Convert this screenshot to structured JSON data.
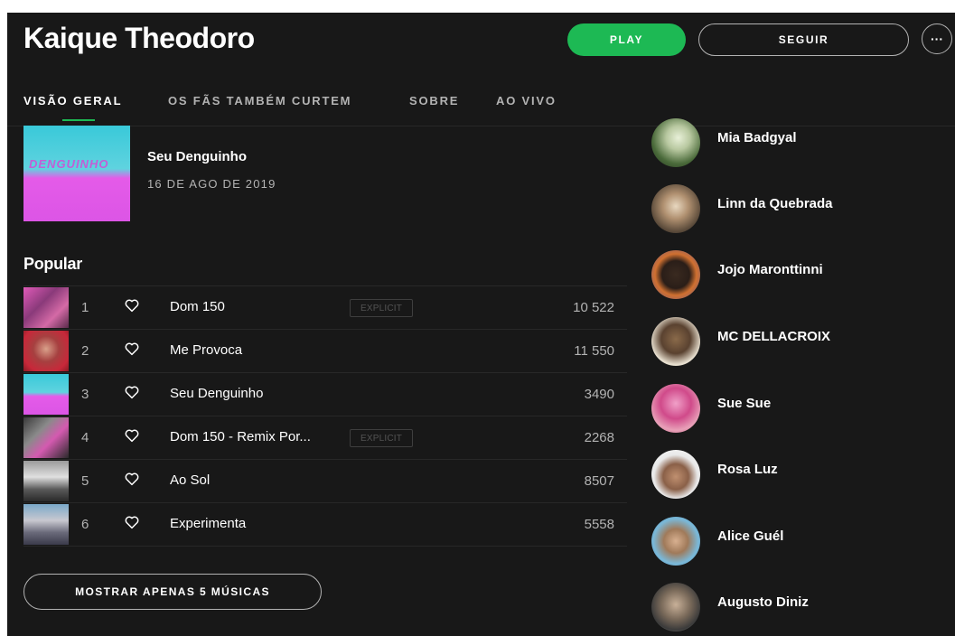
{
  "header": {
    "artist_name": "Kaique Theodoro",
    "play_label": "PLAY",
    "follow_label": "SEGUIR",
    "more_label": "···"
  },
  "tabs": [
    {
      "label": "VISÃO GERAL",
      "active": true
    },
    {
      "label": "OS FÃS TAMBÉM CURTEM",
      "active": false
    },
    {
      "label": "SOBRE",
      "active": false
    },
    {
      "label": "AO VIVO",
      "active": false
    }
  ],
  "latest_release": {
    "title": "Seu Denguinho",
    "date": "16 DE AGO DE 2019",
    "cover_text": "DENGUINHO"
  },
  "popular": {
    "heading": "Popular",
    "explicit_label": "EXPLICIT",
    "tracks": [
      {
        "number": "1",
        "name": "Dom 150",
        "explicit": true,
        "plays": "10 522"
      },
      {
        "number": "2",
        "name": "Me Provoca",
        "explicit": false,
        "plays": "11 550"
      },
      {
        "number": "3",
        "name": "Seu Denguinho",
        "explicit": false,
        "plays": "3490"
      },
      {
        "number": "4",
        "name": "Dom 150 - Remix Por...",
        "explicit": true,
        "plays": "2268"
      },
      {
        "number": "5",
        "name": "Ao Sol",
        "explicit": false,
        "plays": "8507"
      },
      {
        "number": "6",
        "name": "Experimenta",
        "explicit": false,
        "plays": "5558"
      }
    ],
    "show_less_label": "MOSTRAR APENAS 5 MÚSICAS"
  },
  "related_artists": [
    {
      "name": "Mia Badgyal"
    },
    {
      "name": "Linn da Quebrada"
    },
    {
      "name": "Jojo Maronttinni"
    },
    {
      "name": "MC DELLACROIX"
    },
    {
      "name": "Sue Sue"
    },
    {
      "name": "Rosa Luz"
    },
    {
      "name": "Alice Guél"
    },
    {
      "name": "Augusto Diniz"
    }
  ],
  "colors": {
    "background": "#181818",
    "accent": "#1db954",
    "text_primary": "#ffffff",
    "text_secondary": "#b3b3b3",
    "divider": "#282828"
  }
}
